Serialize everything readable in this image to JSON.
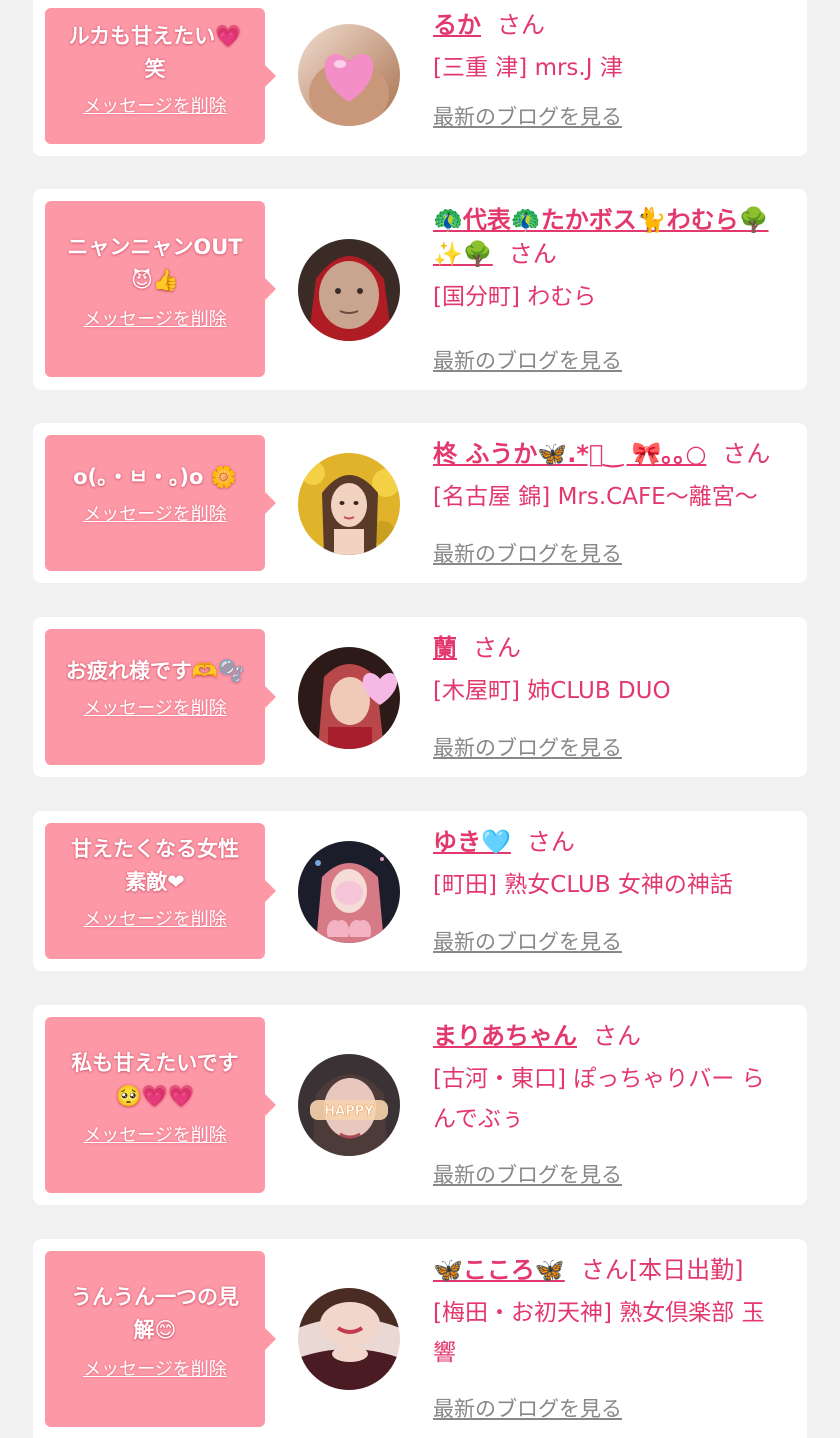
{
  "ui": {
    "delete_label": "メッセージを削除",
    "blog_label": "最新のブログを見る",
    "accent_color": "#e3386d",
    "bubble_color": "#fd98a6"
  },
  "cards": [
    {
      "message": [
        "ルカも甘えたい💗",
        "笑"
      ],
      "name": "るか",
      "name_extra": [
        "",
        ""
      ],
      "san": "さん",
      "shop": [
        "[三重 津] mrs.J 津"
      ]
    },
    {
      "message": [
        "ニャンニャンOUT",
        "😈👍"
      ],
      "name": "🦚代表🦚たかボス🐈わむら🌳",
      "name_extra": [
        "✨🌳",
        ""
      ],
      "san": "さん",
      "shop": [
        "[国分町] わむら"
      ]
    },
    {
      "message": [
        "o(。・ㅂ・。)o 🌼"
      ],
      "name": "柊 ふうか🦋.*ﾟ‿ 🎀｡｡○",
      "name_extra": [
        "",
        ""
      ],
      "san": "さん",
      "shop": [
        "[名古屋 錦] Mrs.CAFE〜離宮〜"
      ]
    },
    {
      "message": [
        "お疲れ様です🫶🫧"
      ],
      "name": "蘭",
      "name_extra": [
        "",
        ""
      ],
      "san": "さん",
      "shop": [
        "[木屋町] 姉CLUB DUO"
      ]
    },
    {
      "message": [
        "甘えたくなる女性",
        "素敵❤"
      ],
      "name": "ゆき🩵",
      "name_extra": [
        "",
        ""
      ],
      "san": "さん",
      "shop": [
        "[町田] 熟女CLUB 女神の神話"
      ]
    },
    {
      "message": [
        "私も甘えたいです",
        "🥺💗💗"
      ],
      "name": "まりあちゃん",
      "name_extra": [
        "",
        ""
      ],
      "san": "さん",
      "shop": [
        "[古河・東口] ぽっちゃりバー ら",
        "んでぶぅ"
      ]
    },
    {
      "message": [
        "うんうん一つの見",
        "解😊"
      ],
      "name": "🦋こころ🦋",
      "name_extra": [
        "",
        ""
      ],
      "san": "さん[本日出勤]",
      "shop": [
        "[梅田・お初天神] 熟女倶楽部 玉",
        "響"
      ]
    }
  ]
}
